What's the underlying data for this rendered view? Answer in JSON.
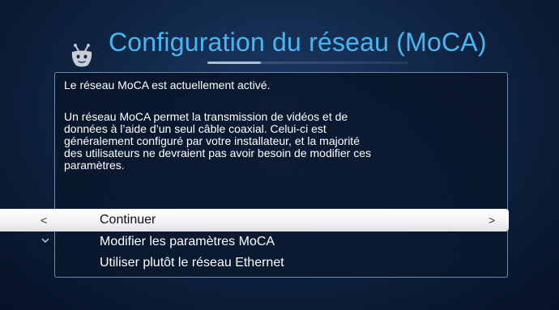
{
  "header": {
    "title": "Configuration du réseau (MoCA)",
    "logo_icon": "tivo-logo-icon"
  },
  "panel": {
    "status": "Le réseau MoCA est actuellement activé.",
    "description_lines": [
      "Un réseau MoCA permet la transmission de vidéos et de",
      "données à l’aide d’un seul câble coaxial. Celui-ci est",
      "généralement configuré par votre installateur, et la majorité",
      "des utilisateurs ne devraient pas avoir besoin de modifier ces",
      "paramètres."
    ]
  },
  "menu": {
    "items": [
      {
        "label": "Continuer",
        "selected": true,
        "left_icon": "chevron-left-icon",
        "right_icon": "chevron-right-icon"
      },
      {
        "label": "Modifier les paramètres MoCA",
        "selected": false
      },
      {
        "label": "Utiliser plutôt le réseau Ethernet",
        "selected": false
      }
    ],
    "scroll_indicator": "chevron-down-icon"
  },
  "colors": {
    "title": "#48b6f5",
    "background": "#102645",
    "highlight": "#ffffff",
    "panel_border": "#6f8aae"
  }
}
